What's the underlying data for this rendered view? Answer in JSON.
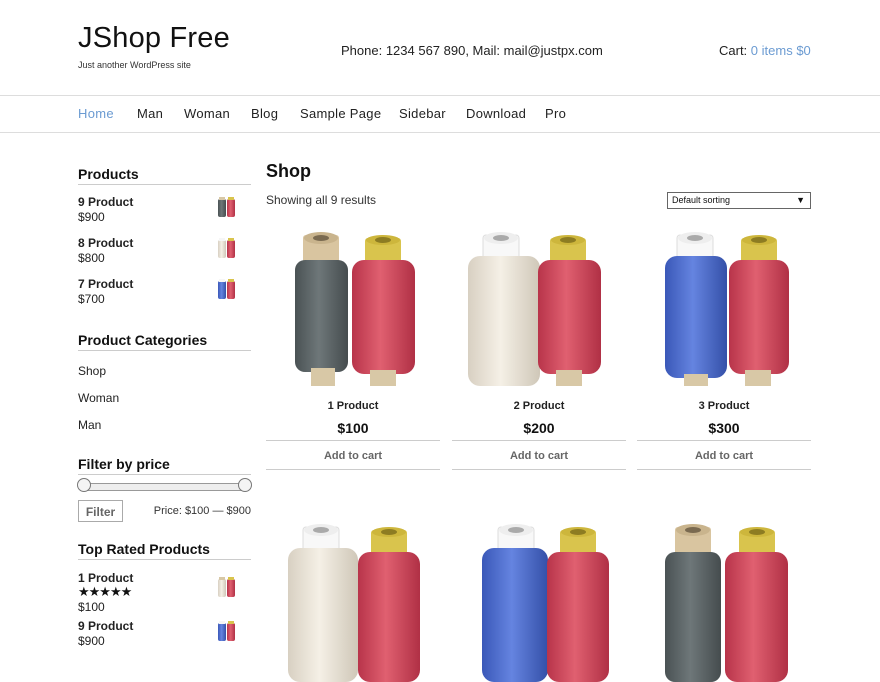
{
  "header": {
    "site_title": "JShop Free",
    "tagline": "Just another WordPress site",
    "contact": "Phone: 1234 567 890, Mail: mail@justpx.com",
    "cart_label": "Cart:",
    "cart_items": "0 items",
    "cart_total": "$0"
  },
  "nav": {
    "items": [
      {
        "label": "Home"
      },
      {
        "label": "Man"
      },
      {
        "label": "Woman"
      },
      {
        "label": "Blog"
      },
      {
        "label": "Sample Page"
      },
      {
        "label": "Sidebar"
      },
      {
        "label": "Download"
      },
      {
        "label": "Pro"
      }
    ]
  },
  "sidebar": {
    "products_title": "Products",
    "products": [
      {
        "name": "9 Product",
        "price": "$900"
      },
      {
        "name": "8 Product",
        "price": "$800"
      },
      {
        "name": "7 Product",
        "price": "$700"
      }
    ],
    "categories_title": "Product Categories",
    "categories": [
      "Shop",
      "Woman",
      "Man"
    ],
    "filter_title": "Filter by price",
    "filter_button": "Filter",
    "price_range": "Price: $100 — $900",
    "top_rated_title": "Top Rated Products",
    "top_rated": [
      {
        "name": "1 Product",
        "stars": "★★★★★",
        "price": "$100"
      },
      {
        "name": "9 Product",
        "price": "$900"
      }
    ]
  },
  "shop": {
    "title": "Shop",
    "result_count": "Showing all 9 results",
    "sorting": "Default sorting",
    "add_to_cart": "Add to cart",
    "products": [
      {
        "name": "1 Product",
        "price": "$100"
      },
      {
        "name": "2 Product",
        "price": "$200"
      },
      {
        "name": "3 Product",
        "price": "$300"
      }
    ]
  },
  "colors": {
    "accent": "#6b9bd2",
    "spool_red": "#d2485a",
    "spool_gray": "#5e6668",
    "spool_cream": "#ebe5d8",
    "spool_blue": "#4f6fd2"
  }
}
